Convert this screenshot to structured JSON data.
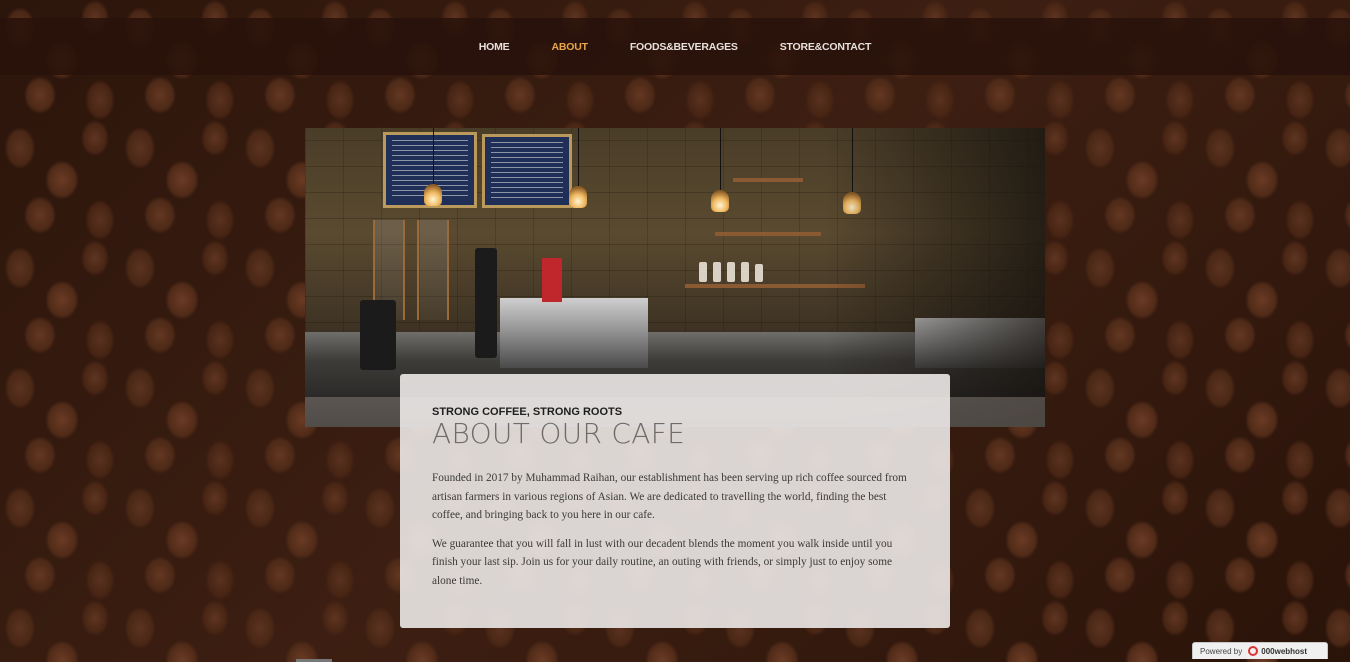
{
  "nav": {
    "items": [
      {
        "label": "HOME"
      },
      {
        "label": "ABOUT",
        "active": true
      },
      {
        "label": "FOODS&BEVERAGES"
      },
      {
        "label": "STORE&CONTACT"
      }
    ]
  },
  "about": {
    "kicker": "Strong Coffee, Strong Roots",
    "title": "About Our Cafe",
    "paragraphs": [
      "Founded in 2017 by Muhammad Raihan, our establishment has been serving up rich coffee sourced from artisan farmers in various regions of Asian. We are dedicated to travelling the world, finding the best coffee, and bringing back to you here in our cafe.",
      "We guarantee that you will fall in lust with our decadent blends the moment you walk inside until you finish your last sip. Join us for your daily routine, an outing with friends, or simply just to enjoy some alone time."
    ]
  },
  "badge": {
    "prefix": "Powered by",
    "brand": "000webhost",
    "icon": "000webhost-logo-icon"
  },
  "colors": {
    "nav_active": "#e8a64a",
    "nav_text": "#e8e0dc",
    "nav_bg": "#28120a"
  }
}
